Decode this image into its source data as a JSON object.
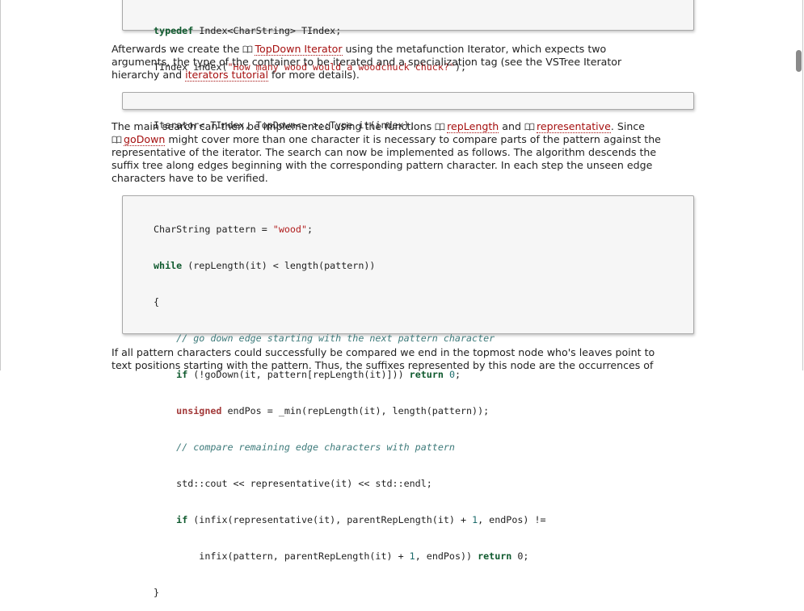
{
  "code1": {
    "line1": "typedef Index<CharString> TIndex;",
    "line2_a": "TIndex index(",
    "line2_str": "\"How many wood would a woodchuck chuck?\"",
    "line2_b": ");"
  },
  "para1": {
    "t1": "Afterwards we create the ",
    "link_topdown": "TopDown Iterator",
    "t2": " using the metafunction Iterator, which expects two",
    "line2": "arguments, the type of the container to be iterated and a specialization tag (see the VSTree Iterator",
    "t3": "hierarchy and ",
    "link_iterators": "iterators tutorial",
    "t4": " for more details)."
  },
  "code2": {
    "line1": "Iterator< TIndex, TopDown<> >::Type it(index);"
  },
  "para2": {
    "t1": "The main search can then be implemented using the functions ",
    "link_replength": "repLength",
    "t2": " and ",
    "link_representative": "representative",
    "t3": ". Since",
    "link_godown": "goDown",
    "t4": " might cover more than one character it is necessary to compare parts of the pattern against the",
    "line3": "representative of the iterator. The search can now be implemented as follows. The algorithm descends the",
    "line4": "suffix tree along edges beginning with the corresponding pattern character. In each step the unseen edge",
    "line5": "characters have to be verified."
  },
  "code3": {
    "l1a": "CharString pattern = ",
    "l1s": "\"wood\"",
    "l1b": ";",
    "l2k": "while",
    "l2b": " (repLength(it) < length(pattern))",
    "l3": "{",
    "l4": "    // go down edge starting with the next pattern character",
    "l5a": "    ",
    "l5k": "if",
    "l5b": " (!goDown(it, pattern[repLength(it)])) ",
    "l5r": "return",
    "l5n": " 0",
    "l5c": ";",
    "l6a": "    ",
    "l6k": "unsigned",
    "l6b": " endPos = _min(repLength(it), length(pattern));",
    "l7": "    // compare remaining edge characters with pattern",
    "l8": "    std::cout << representative(it) << std::endl;",
    "l9a": "    ",
    "l9k": "if",
    "l9b": " (infix(representative(it), parentRepLength(it) + ",
    "l9n": "1",
    "l9c": ", endPos) !=",
    "l10a": "        infix(pattern, parentRepLength(it) + ",
    "l10n": "1",
    "l10b": ", endPos)) ",
    "l10r": "return",
    "l10c": " 0;",
    "l11": "}"
  },
  "para3": {
    "line1": "If all pattern characters could successfully be compared we end in the topmost node who's leaves point to",
    "line2": "text positions starting with the pattern. Thus, the suffixes represented by this node are the occurrences of"
  },
  "icons": {
    "doc_link": "book-icon"
  },
  "colors": {
    "link": "#a50f0f",
    "keyword": "#0f5a2e",
    "string": "#b01c1c",
    "comment": "#3d7a7a"
  }
}
